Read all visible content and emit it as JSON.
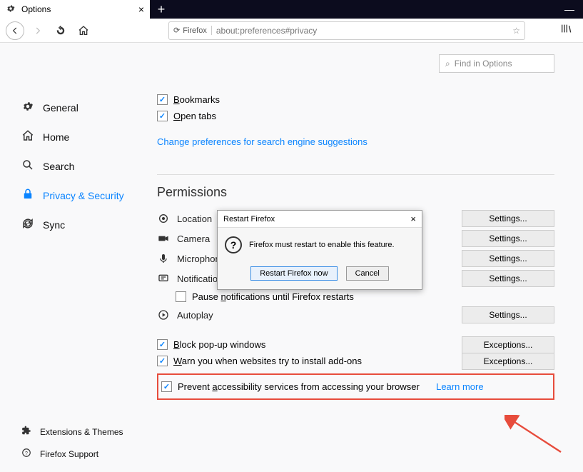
{
  "tab": {
    "title": "Options",
    "close": "×"
  },
  "newtab": "+",
  "wincontrol_min": "—",
  "urlbar": {
    "badge_icon": "⟳",
    "badge_text": "Firefox",
    "url": "about:preferences#privacy",
    "star": "☆"
  },
  "find": {
    "placeholder": "Find in Options",
    "icon": "⌕"
  },
  "sidebar": {
    "general": "General",
    "home": "Home",
    "search": "Search",
    "privacy": "Privacy & Security",
    "sync": "Sync",
    "extensions": "Extensions & Themes",
    "support": "Firefox Support"
  },
  "checks": {
    "bookmarks": "Bookmarks",
    "open_tabs": "Open tabs",
    "block_popups": "Block pop-up windows",
    "warn_addons": "Warn you when websites try to install add-ons",
    "prevent_a11y": "Prevent accessibility services from accessing your browser",
    "pause_notif": "Pause notifications until Firefox restarts"
  },
  "links": {
    "search_prefs": "Change preferences for search engine suggestions",
    "learn_more": "Learn more"
  },
  "section": {
    "permissions": "Permissions"
  },
  "perms": {
    "location": "Location",
    "camera": "Camera",
    "microphone": "Microphone",
    "notifications": "Notifications",
    "autoplay": "Autoplay"
  },
  "buttons": {
    "settings": "Settings...",
    "exceptions": "Exceptions..."
  },
  "dialog": {
    "title": "Restart Firefox",
    "message": "Firefox must restart to enable this feature.",
    "restart": "Restart Firefox now",
    "cancel": "Cancel",
    "close": "×"
  }
}
